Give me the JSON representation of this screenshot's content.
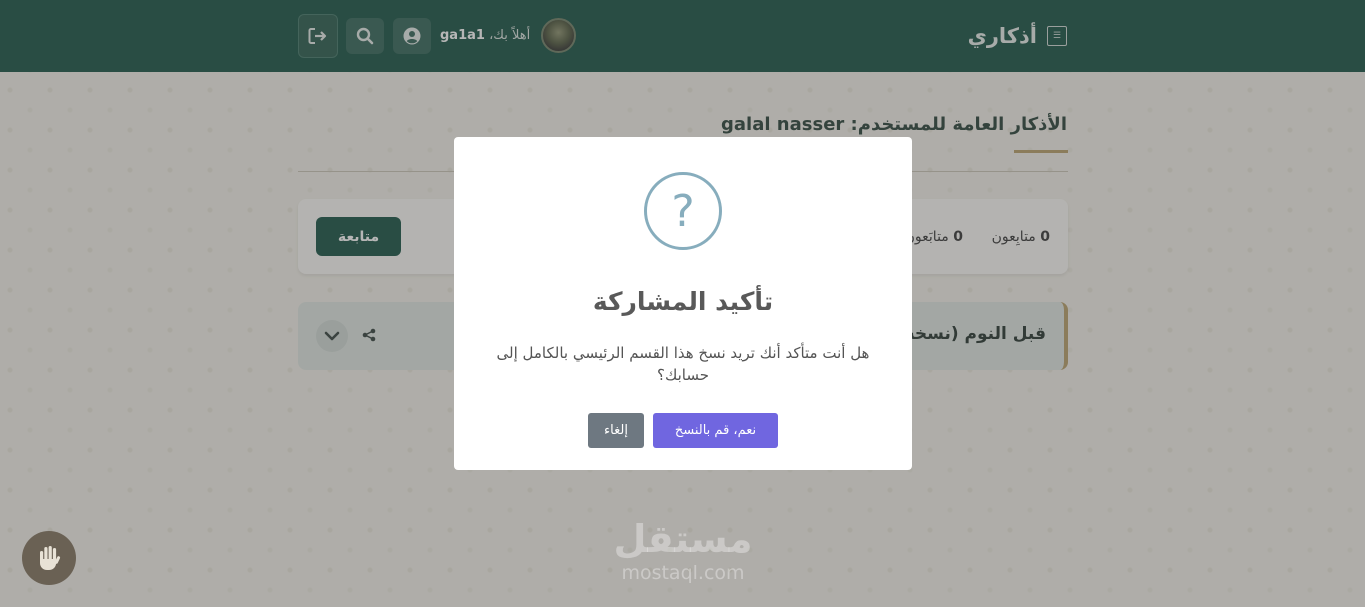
{
  "header": {
    "brand_title": "أذكاري",
    "brand_icon": "quran-icon",
    "greeting_prefix": "أهلاً بك،",
    "username": "ga1a1",
    "buttons": [
      "logout-icon",
      "search-icon",
      "user-icon"
    ]
  },
  "profile": {
    "page_title": "الأذكار العامة للمستخدم: galal nasser",
    "followers_count": "0",
    "followers_label": "متابِعون",
    "following_count": "0",
    "following_label": "متابَعون",
    "follow_button": "متابعة"
  },
  "section": {
    "title": "قبل النوم (نسخة"
  },
  "modal": {
    "icon": "question-icon",
    "icon_glyph": "?",
    "title": "تأكيد المشاركة",
    "text": "هل أنت متأكد أنك تريد نسخ هذا القسم الرئيسي بالكامل إلى حسابك؟",
    "confirm_label": "نعم، قم بالنسخ",
    "cancel_label": "إلغاء"
  },
  "fab": {
    "icon": "hand-icon"
  },
  "watermark": {
    "arabic": "مستقل",
    "latin": "mostaql.com"
  },
  "colors": {
    "header_bg": "#0d4a3b",
    "accent_gold": "#b59b62",
    "confirm_button": "#7066e0",
    "cancel_button": "#6e7881",
    "question_icon": "#87adbd"
  }
}
